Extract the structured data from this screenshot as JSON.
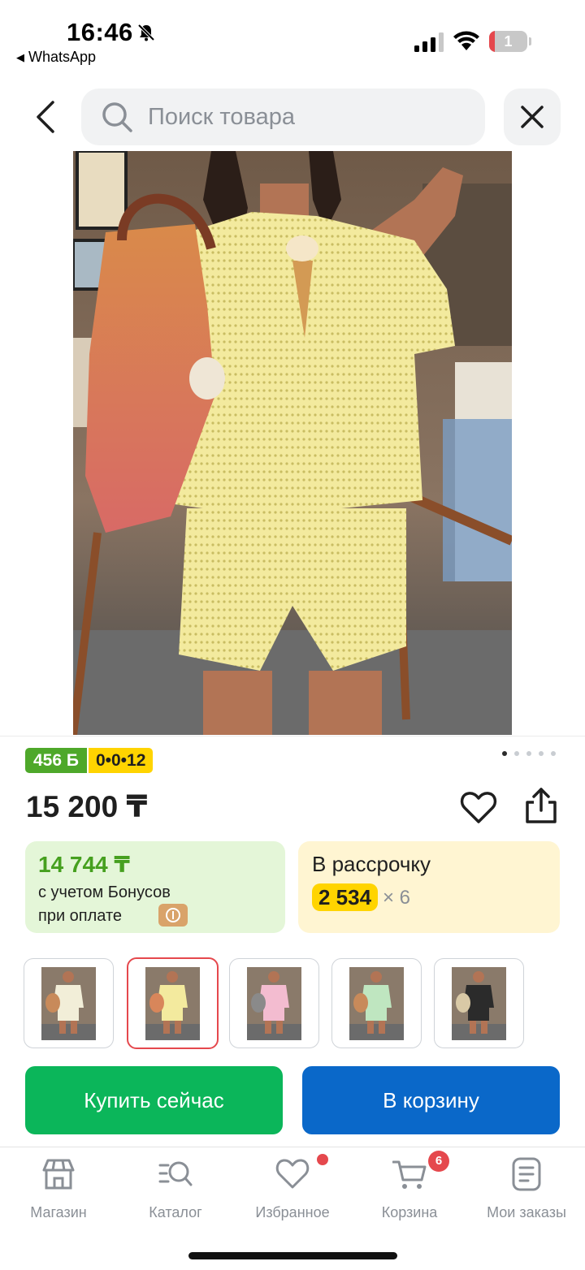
{
  "status_bar": {
    "time": "16:46",
    "back_app": "WhatsApp",
    "battery_level": "1",
    "battery_color": "#e5484d"
  },
  "header": {
    "search_placeholder": "Поиск товара",
    "back_icon": "chevron-left-icon",
    "close_icon": "close-icon"
  },
  "product": {
    "bonus_badge": "456 Б",
    "installment_badge": "0•0•12",
    "gallery_dots": 5,
    "gallery_active_index": 0,
    "price": "15 200 ₸",
    "bonus_card": {
      "price": "14 744 ₸",
      "line1": "с учетом Бонусов",
      "line2": "при оплате"
    },
    "installment_card": {
      "title": "В рассрочку",
      "amount": "2 534",
      "multiplier": "× 6"
    },
    "variants": [
      {
        "color": "cream",
        "selected": false
      },
      {
        "color": "yellow",
        "selected": true
      },
      {
        "color": "pink",
        "selected": false
      },
      {
        "color": "mint",
        "selected": false
      },
      {
        "color": "black",
        "selected": false
      }
    ]
  },
  "actions": {
    "buy_now": "Купить сейчас",
    "add_to_cart": "В корзину"
  },
  "tabbar": {
    "items": [
      {
        "label": "Магазин",
        "icon": "store-icon"
      },
      {
        "label": "Каталог",
        "icon": "catalog-search-icon"
      },
      {
        "label": "Избранное",
        "icon": "heart-icon"
      },
      {
        "label": "Корзина",
        "icon": "cart-icon"
      },
      {
        "label": "Мои заказы",
        "icon": "orders-icon"
      }
    ],
    "cart_count": "6"
  },
  "colors": {
    "green_button": "#0bb65a",
    "blue_button": "#0a68c9",
    "bonus_green": "#4ea82a",
    "accent_yellow": "#ffd400",
    "selected_border": "#e5484d"
  }
}
